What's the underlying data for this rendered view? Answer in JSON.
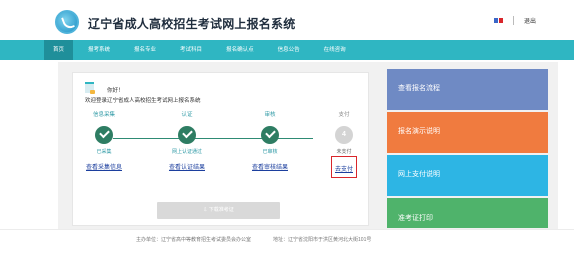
{
  "header": {
    "title": "辽宁省成人高校招生考试网上报名系统",
    "logout_label": "退出"
  },
  "nav": {
    "items": [
      "首页",
      "报考系统",
      "报名专业",
      "考试科目",
      "报名确认点",
      "信息公告",
      "在线咨询"
    ],
    "active_index": 0
  },
  "welcome": {
    "greeting": "你好！",
    "message": "欢迎登录辽宁省成人高校招生考试网上报名系统"
  },
  "steps": [
    {
      "label": "信息采集",
      "status": "已采集",
      "link": "查看采集信息",
      "state": "done"
    },
    {
      "label": "认证",
      "status": "网上认证通过",
      "link": "查看认证结果",
      "state": "done"
    },
    {
      "label": "审核",
      "status": "已审核",
      "link": "查看审核结果",
      "state": "done"
    },
    {
      "label": "支付",
      "number": "4",
      "status": "未支付",
      "link": "去支付",
      "state": "todo"
    }
  ],
  "download_button": "下载准考证",
  "tiles": [
    "查看报名流程",
    "报名演示说明",
    "网上支付说明",
    "准考证打印"
  ],
  "footer": {
    "host": "主办单位：辽宁省高中等教育招生考试委员会办公室",
    "address": "地址：辽宁省沈阳市于洪区黄河北大街101号"
  },
  "colors": {
    "nav": "#2fb6c2",
    "step_done": "#2e7d63",
    "pay_highlight": "#d9262b",
    "tile1": "#6f8ac4",
    "tile2": "#f07b3f",
    "tile3": "#2db5e4",
    "tile4": "#4fb36b"
  }
}
